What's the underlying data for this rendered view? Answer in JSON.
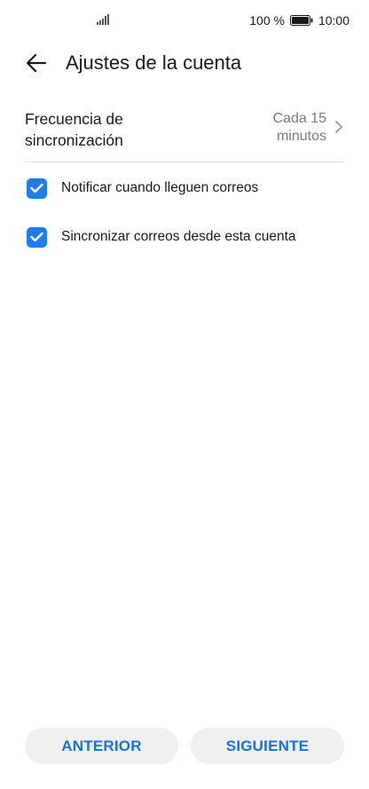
{
  "status_bar": {
    "battery_percent": "100 %",
    "time": "10:00",
    "icons": [
      "signal-icon",
      "battery-icon"
    ]
  },
  "header": {
    "title": "Ajustes de la cuenta",
    "back_icon": "arrow-left-icon"
  },
  "sync_frequency": {
    "label": "Frecuencia de sincronización",
    "value": "Cada 15 minutos"
  },
  "options": [
    {
      "label": "Notificar cuando lleguen correos",
      "checked": true
    },
    {
      "label": "Sincronizar correos desde esta cuenta",
      "checked": true
    }
  ],
  "footer": {
    "previous_label": "ANTERIOR",
    "next_label": "SIGUIENTE"
  },
  "colors": {
    "accent": "#1e7cf0",
    "button_text": "#1672e0",
    "button_bg": "#efefef"
  }
}
